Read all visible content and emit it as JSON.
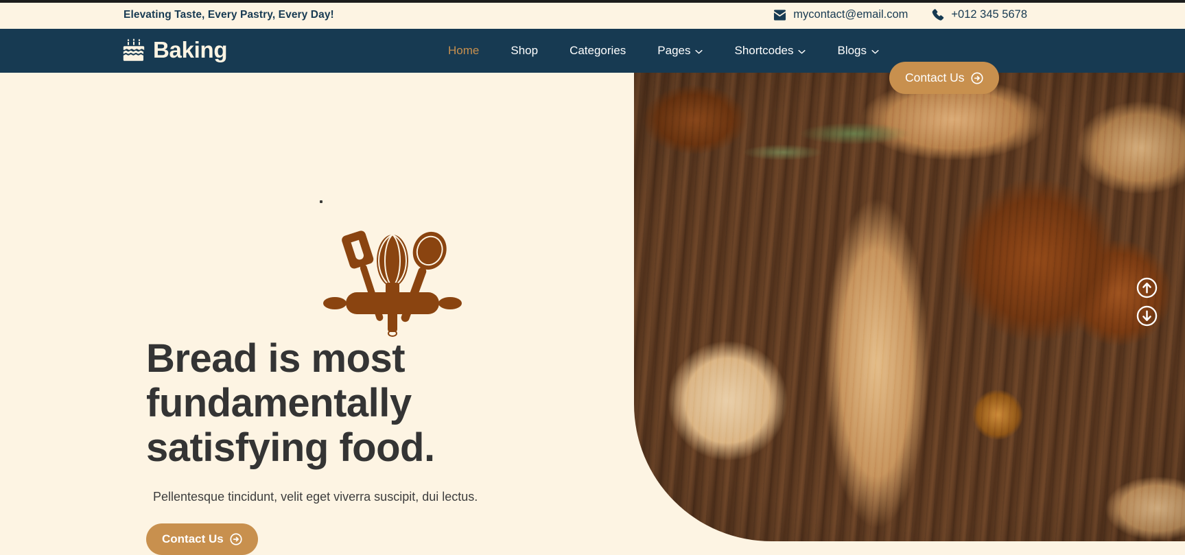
{
  "topbar": {
    "tagline": "Elevating Taste, Every Pastry, Every Day!",
    "email": "mycontact@email.com",
    "email_icon": "envelope-icon",
    "phone": "+012 345 5678",
    "phone_icon": "phone-icon"
  },
  "brand": {
    "name": "Baking",
    "icon": "cake-icon"
  },
  "nav": {
    "items": [
      {
        "label": "Home",
        "active": true,
        "has_dropdown": false
      },
      {
        "label": "Shop",
        "active": false,
        "has_dropdown": false
      },
      {
        "label": "Categories",
        "active": false,
        "has_dropdown": false
      },
      {
        "label": "Pages",
        "active": false,
        "has_dropdown": true
      },
      {
        "label": "Shortcodes",
        "active": false,
        "has_dropdown": true
      },
      {
        "label": "Blogs",
        "active": false,
        "has_dropdown": true
      }
    ],
    "cta_label": "Contact Us",
    "cta_icon": "arrow-right-circle-icon"
  },
  "hero": {
    "decor_icon": "baking-utensils-icon",
    "title": "Bread is most fundamentally satisfying food.",
    "subtitle": "Pellentesque tincidunt, velit eget viverra suscipit, dui lectus.",
    "cta_label": "Contact Us",
    "cta_icon": "arrow-right-circle-icon",
    "image_alt": "Assorted fresh baked breads, pretzels and baguettes with rosemary on a wooden board",
    "slider_up_icon": "arrow-up-circle-icon",
    "slider_down_icon": "arrow-down-circle-icon"
  },
  "colors": {
    "cream": "#fdf4e3",
    "navy": "#173a52",
    "accent_gold": "#c8904e",
    "heading": "#343434",
    "utensil_brown": "#8a4410"
  }
}
